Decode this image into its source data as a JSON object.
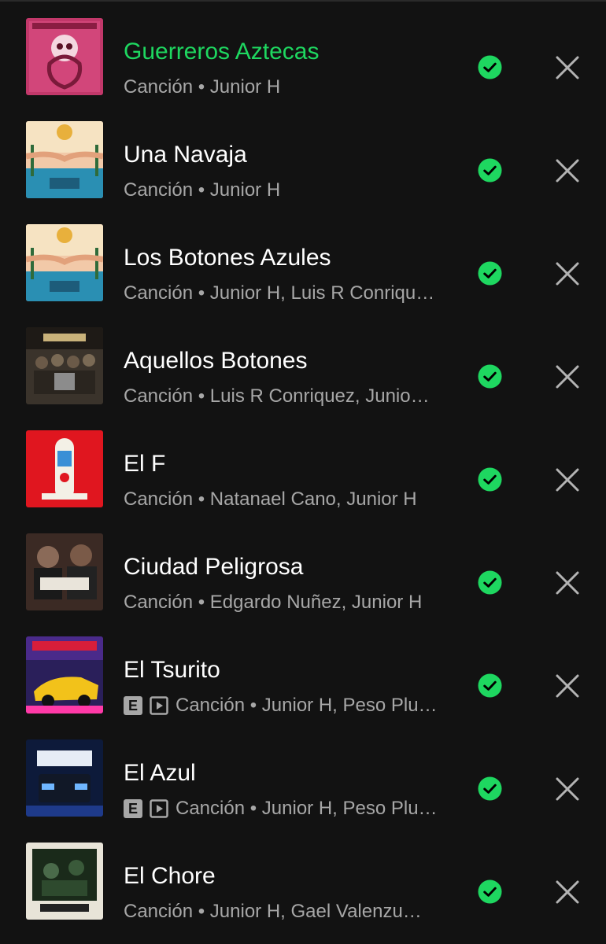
{
  "colors": {
    "background": "#121212",
    "accent": "#1ed760",
    "text": "#ffffff",
    "subtext": "#a7a7a7"
  },
  "items": [
    {
      "title": "Guerreros Aztecas",
      "subtitle": "Canción • Junior H",
      "active": true,
      "explicit": false,
      "video": false
    },
    {
      "title": "Una Navaja",
      "subtitle": "Canción • Junior H",
      "active": false,
      "explicit": false,
      "video": false
    },
    {
      "title": "Los Botones Azules",
      "subtitle": "Canción • Junior H, Luis R Conriqu…",
      "active": false,
      "explicit": false,
      "video": false
    },
    {
      "title": "Aquellos Botones",
      "subtitle": "Canción • Luis R Conriquez, Junio…",
      "active": false,
      "explicit": false,
      "video": false
    },
    {
      "title": "El F",
      "subtitle": "Canción • Natanael Cano, Junior H",
      "active": false,
      "explicit": false,
      "video": false
    },
    {
      "title": "Ciudad Peligrosa",
      "subtitle": "Canción • Edgardo Nuñez, Junior H",
      "active": false,
      "explicit": false,
      "video": false
    },
    {
      "title": "El Tsurito",
      "subtitle": "Canción • Junior H, Peso Plu…",
      "active": false,
      "explicit": true,
      "explicit_label": "E",
      "video": true
    },
    {
      "title": "El Azul",
      "subtitle": "Canción • Junior H, Peso Plu…",
      "active": false,
      "explicit": true,
      "explicit_label": "E",
      "video": true
    },
    {
      "title": "El Chore",
      "subtitle": "Canción • Junior H, Gael Valenzu…",
      "active": false,
      "explicit": false,
      "video": false
    }
  ],
  "icons": {
    "added": "check-circle-icon",
    "remove": "close-icon",
    "explicit": "explicit-badge",
    "video": "video-play-icon"
  }
}
